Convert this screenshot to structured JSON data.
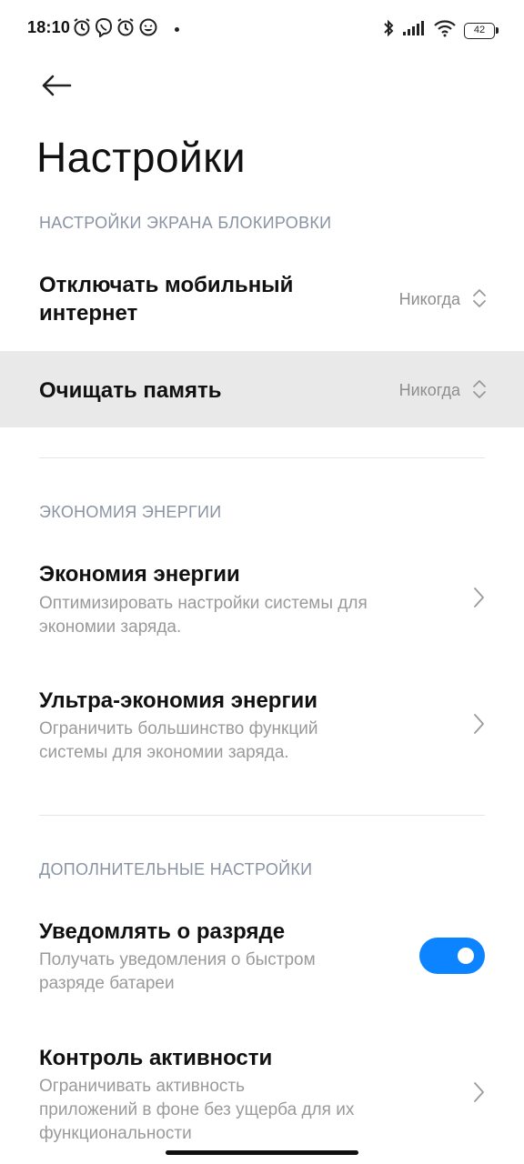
{
  "status_bar": {
    "time": "18:10",
    "battery_level": "42",
    "icons": [
      "alarm-icon",
      "viber-icon",
      "alarm-icon",
      "emoji-icon",
      "bluetooth-icon",
      "signal-icon",
      "wifi-icon",
      "battery-icon"
    ]
  },
  "header": {
    "back_icon": "arrow-left-icon",
    "title": "Настройки"
  },
  "sections": {
    "lock_screen": {
      "header": "НАСТРОЙКИ ЭКРАНА БЛОКИРОВКИ",
      "disable_mobile_data": {
        "title_line1": "Отключать мобильный",
        "title_line2": "интернет",
        "value": "Никогда"
      },
      "clear_memory": {
        "title": "Очищать память",
        "value": "Никогда"
      }
    },
    "battery_saver": {
      "header": "ЭКОНОМИЯ ЭНЕРГИИ",
      "saver": {
        "title": "Экономия энергии",
        "desc_line1": "Оптимизировать настройки системы для",
        "desc_line2": "экономии заряда."
      },
      "ultra_saver": {
        "title": "Ультра-экономия энергии",
        "desc_line1": "Ограничить большинство функций",
        "desc_line2": "системы для экономии заряда."
      }
    },
    "advanced": {
      "header": "ДОПОЛНИТЕЛЬНЫЕ НАСТРОЙКИ",
      "notify_drain": {
        "title": "Уведомлять о разряде",
        "desc_line1": "Получать уведомления о быстром",
        "desc_line2": "разряде батареи",
        "enabled": true
      },
      "activity_control": {
        "title": "Контроль активности",
        "desc_line1": "Ограничивать активность",
        "desc_line2": "приложений в фоне без ущерба для их",
        "desc_line3": "функциональности"
      }
    }
  },
  "colors": {
    "accent": "#0d84ff",
    "section_header": "#8a93a3",
    "highlight_row": "#e9e9e9"
  }
}
